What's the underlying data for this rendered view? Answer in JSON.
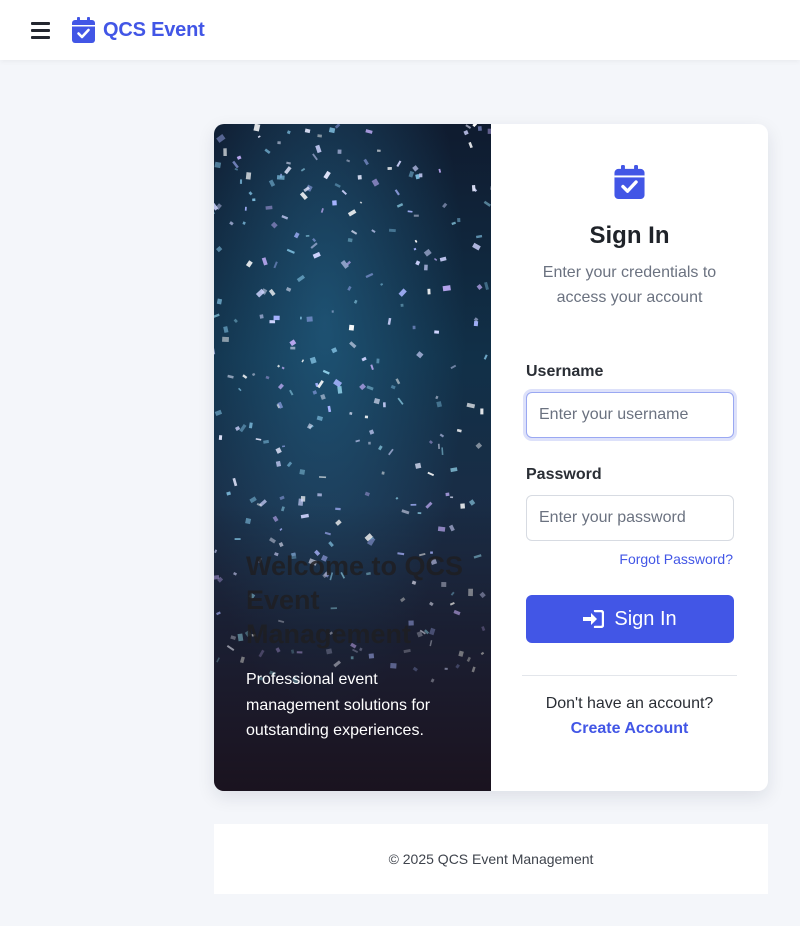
{
  "navbar": {
    "menu_icon": "hamburger-menu-icon",
    "brand_icon": "calendar-check-icon",
    "brand_name": "QCS Event"
  },
  "hero": {
    "title": "Welcome to QCS Event Management",
    "subtitle": "Professional event management solutions for outstanding experiences."
  },
  "login": {
    "icon": "calendar-check-icon",
    "title": "Sign In",
    "subtitle": "Enter your credentials to access your account",
    "username_label": "Username",
    "username_placeholder": "Enter your username",
    "username_value": "",
    "password_label": "Password",
    "password_placeholder": "Enter your password",
    "password_value": "",
    "forgot_link": "Forgot Password?",
    "submit_icon": "sign-in-arrow-icon",
    "submit_label": "Sign In",
    "no_account_text": "Don't have an account?",
    "create_account_link": "Create Account"
  },
  "footer": {
    "copyright": "© 2025 QCS Event Management"
  },
  "colors": {
    "accent": "#4256e6",
    "page_background": "#f4f6fa",
    "text_muted": "#6b7280"
  }
}
